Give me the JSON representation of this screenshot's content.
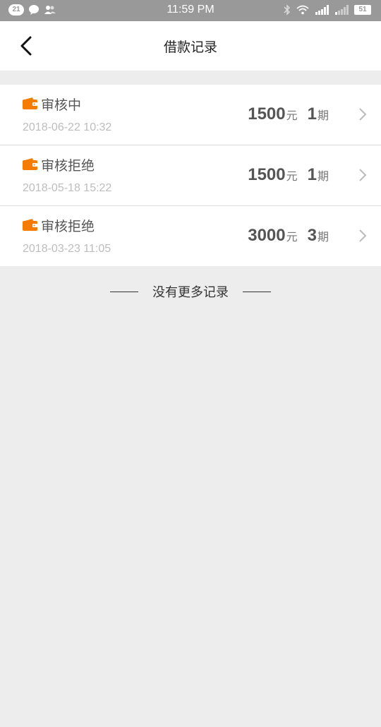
{
  "status_bar": {
    "notification_count": "21",
    "time": "11:59 PM",
    "battery": "51"
  },
  "header": {
    "title": "借款记录"
  },
  "records": [
    {
      "status": "审核中",
      "date": "2018-06-22 10:32",
      "amount": "1500",
      "amount_unit": "元",
      "period": "1",
      "period_unit": "期"
    },
    {
      "status": "审核拒绝",
      "date": "2018-05-18 15:22",
      "amount": "1500",
      "amount_unit": "元",
      "period": "1",
      "period_unit": "期"
    },
    {
      "status": "审核拒绝",
      "date": "2018-03-23 11:05",
      "amount": "3000",
      "amount_unit": "元",
      "period": "3",
      "period_unit": "期"
    }
  ],
  "footer": {
    "no_more_text": "没有更多记录"
  },
  "colors": {
    "accent": "#f57c00",
    "status_bar": "#999999",
    "background": "#ededed"
  }
}
